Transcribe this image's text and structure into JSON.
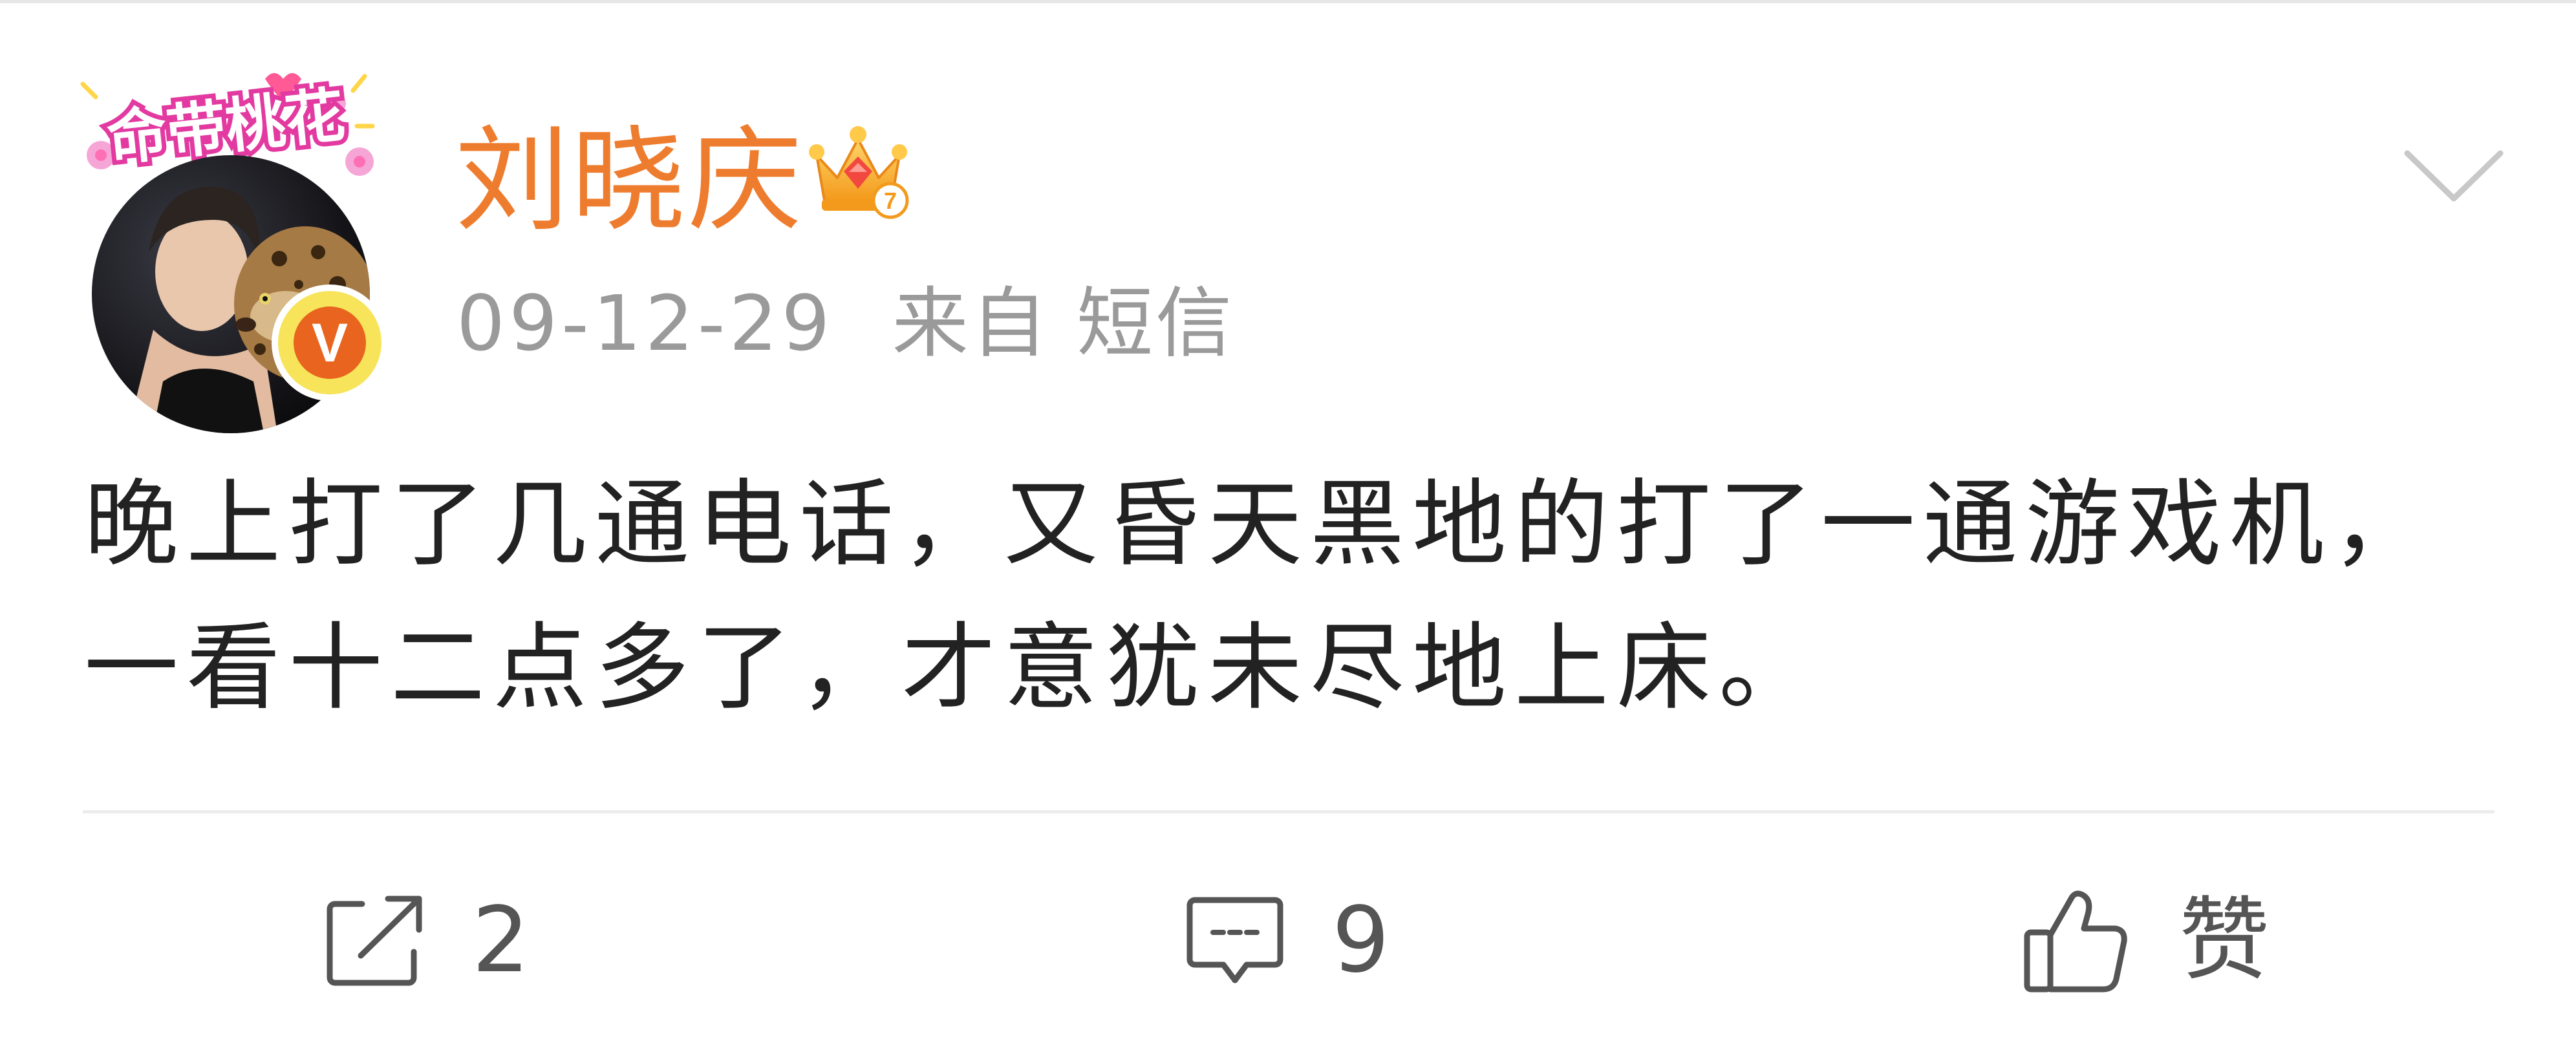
{
  "post": {
    "author": {
      "name": "刘晓庆",
      "avatar_frame_text": "命带桃花",
      "verified_badge_letter": "V",
      "verified_color": "#e8641f",
      "name_color": "#ee7c2e",
      "crown_badge_icon": "crown-icon"
    },
    "time": "09-12-29",
    "source": "来自 短信",
    "text_lines": [
      "晚上打了几通电话，又昏天黑地的打了一通游戏机，",
      "一看十二点多了，才意犹未尽地上床。"
    ]
  },
  "actions": {
    "repost": {
      "icon": "share-icon",
      "count": "2"
    },
    "comment": {
      "icon": "comment-icon",
      "count": "9"
    },
    "like": {
      "icon": "thumbs-up-icon",
      "label": "赞"
    }
  },
  "more_menu_icon": "chevron-down-icon"
}
